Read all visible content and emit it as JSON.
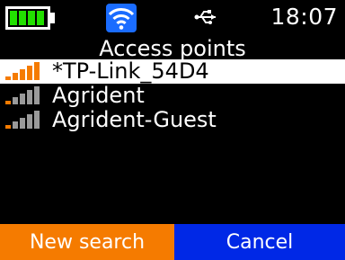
{
  "status": {
    "time": "18:07",
    "battery_icon": "battery-full-icon",
    "wifi_icon": "wifi-icon",
    "usb_icon": "usb-icon",
    "colors": {
      "battery": "#22e000",
      "wifi": "#1a6cff",
      "signal_active": "#f57b00",
      "signal_inactive": "#9a9a9a"
    }
  },
  "screen": {
    "title": "Access points"
  },
  "access_points": [
    {
      "name": "*TP-Link_54D4",
      "signal_bars": 4,
      "selected": true
    },
    {
      "name": "Agrident",
      "signal_bars": 1,
      "selected": false
    },
    {
      "name": "Agrident-Guest",
      "signal_bars": 1,
      "selected": false
    }
  ],
  "softkeys": {
    "left_label": "New search",
    "right_label": "Cancel",
    "left_color": "#f57b00",
    "right_color": "#0028e6"
  }
}
